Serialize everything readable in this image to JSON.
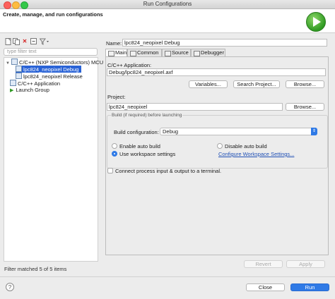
{
  "window": {
    "title": "Run Configurations"
  },
  "header": {
    "heading": "Create, manage, and run configurations"
  },
  "toolbar": {
    "buttons": [
      {
        "icon": "new-config-icon"
      },
      {
        "icon": "duplicate-icon"
      },
      {
        "icon": "delete-icon"
      },
      {
        "icon": "collapse-all-icon"
      },
      {
        "icon": "filter-icon"
      }
    ]
  },
  "filter": {
    "placeholder": "type filter text"
  },
  "tree": {
    "items": [
      {
        "label": "C/C++ (NXP Semiconductors) MCU",
        "level": 0,
        "expanded": true
      },
      {
        "label": "lpc824_neopixel Debug",
        "level": 1,
        "selected": true
      },
      {
        "label": "lpc824_neopixel Release",
        "level": 1
      },
      {
        "label": "C/C++ Application",
        "level": 0
      },
      {
        "label": "Launch Group",
        "level": 0
      }
    ],
    "status": "Filter matched 5 of 5 items"
  },
  "config": {
    "name_label": "Name:",
    "name_value": "lpc824_neopixel Debug",
    "tabs": [
      "Main",
      "Common",
      "Source",
      "Debugger"
    ],
    "active_tab": "Main",
    "app_label": "C/C++ Application:",
    "app_value": "Debug/lpc824_neopixel.axf",
    "variables_button": "Variables...",
    "search_project_button": "Search Project...",
    "browse_button": "Browse...",
    "project_label": "Project:",
    "project_value": "lpc824_neopixel",
    "project_browse_button": "Browse...",
    "build_group_label": "Build (if required) before launching",
    "build_config_label": "Build configuration:",
    "build_config_value": "Debug",
    "radio_enable_auto": "Enable auto build",
    "radio_disable_auto": "Disable auto build",
    "radio_workspace": "Use workspace settings",
    "workspace_link": "Configure Workspace Settings...",
    "connect_checkbox": "Connect process input & output to a terminal.",
    "revert_button": "Revert",
    "apply_button": "Apply"
  },
  "footer": {
    "help": "?",
    "close_button": "Close",
    "run_button": "Run"
  }
}
